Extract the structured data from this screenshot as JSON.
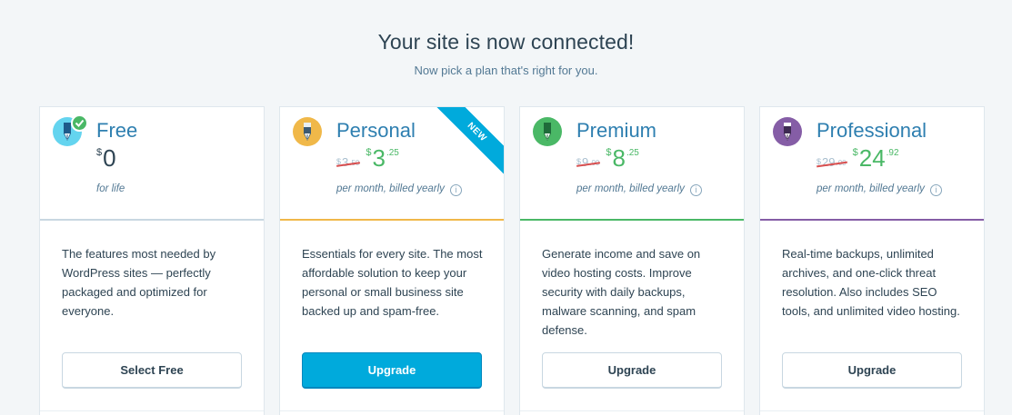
{
  "header": {
    "title": "Your site is now connected!",
    "subtitle": "Now pick a plan that's right for you."
  },
  "colors": {
    "free": "#64d4ef",
    "personal": "#f0b849",
    "premium": "#4ab866",
    "professional": "#855da6",
    "accent": "#00aadc"
  },
  "plans": [
    {
      "name": "Free",
      "icon": "free-plan-icon",
      "currency": "$",
      "price": "0",
      "billing": "for life",
      "description": "The features most needed by WordPress sites — perfectly packaged and optimized for everyone.",
      "button": "Select Free"
    },
    {
      "name": "Personal",
      "icon": "personal-plan-icon",
      "currency": "$",
      "old_price": "3",
      "old_cents": ".50",
      "price": "3",
      "cents": ".25",
      "billing": "per month, billed yearly",
      "description": "Essentials for every site. The most affordable solution to keep your personal or small business site backed up and spam-free.",
      "button": "Upgrade",
      "ribbon": "NEW"
    },
    {
      "name": "Premium",
      "icon": "premium-plan-icon",
      "currency": "$",
      "old_price": "9",
      "old_cents": ".00",
      "price": "8",
      "cents": ".25",
      "billing": "per month, billed yearly",
      "description": "Generate income and save on video hosting costs. Improve security with daily backups, malware scanning, and spam defense.",
      "button": "Upgrade"
    },
    {
      "name": "Professional",
      "icon": "professional-plan-icon",
      "currency": "$",
      "old_price": "29",
      "old_cents": ".00",
      "price": "24",
      "cents": ".92",
      "billing": "per month, billed yearly",
      "description": "Real-time backups, unlimited archives, and one-click threat resolution. Also includes SEO tools, and unlimited video hosting.",
      "button": "Upgrade"
    }
  ],
  "info_icon_glyph": "i"
}
